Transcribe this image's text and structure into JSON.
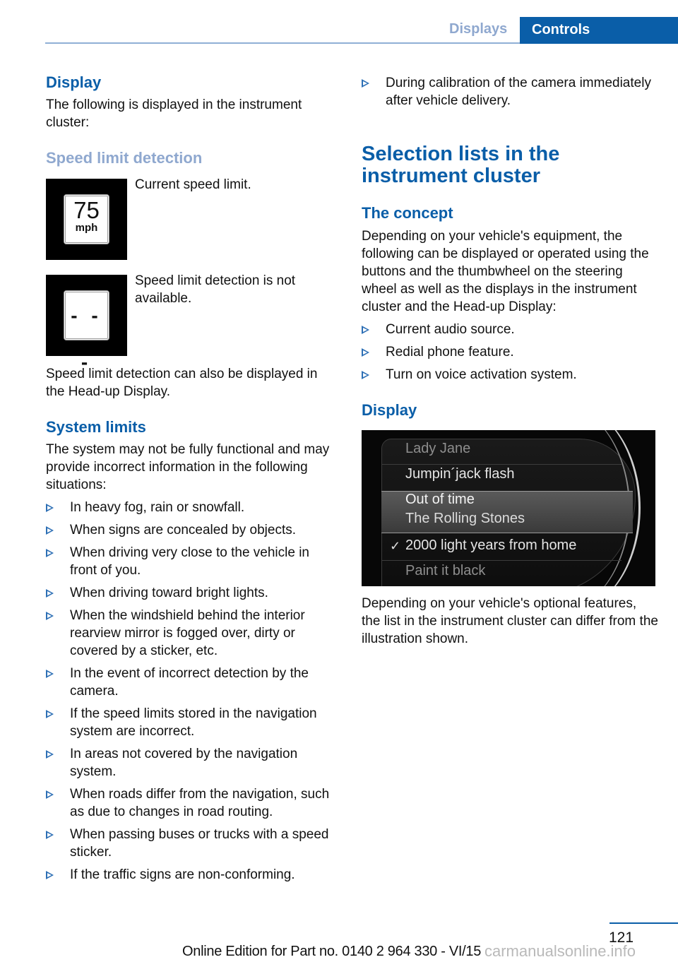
{
  "header": {
    "section_tab": "Displays",
    "chapter_tab": "Controls"
  },
  "left": {
    "display_heading": "Display",
    "display_intro": "The following is displayed in the instrument cluster:",
    "speed_heading": "Speed limit detection",
    "signs": [
      {
        "icon": "speed-limit-75-mph-sign",
        "number": "75",
        "unit": "mph",
        "caption": "Current speed limit."
      },
      {
        "icon": "speed-limit-unavailable-sign",
        "dashes": "- - -",
        "caption": "Speed limit detection is not available."
      }
    ],
    "hud_note": "Speed limit detection can also be displayed in the Head-up Display.",
    "limits_heading": "System limits",
    "limits_intro": "The system may not be fully functional and may provide incorrect information in the following situations:",
    "limits_items": [
      "In heavy fog, rain or snowfall.",
      "When signs are concealed by objects.",
      "When driving very close to the vehicle in front of you.",
      "When driving toward bright lights.",
      "When the windshield behind the interior rearview mirror is fogged over, dirty or covered by a sticker, etc.",
      "In the event of incorrect detection by the camera.",
      "If the speed limits stored in the navigation system are incorrect.",
      "In areas not covered by the navigation system.",
      "When roads differ from the navigation, such as due to changes in road routing.",
      "When passing buses or trucks with a speed sticker.",
      "If the traffic signs are non-conforming."
    ]
  },
  "right": {
    "cont_items": [
      "During calibration of the camera immediately after vehicle delivery."
    ],
    "selection_heading": "Selection lists in the instrument cluster",
    "concept_heading": "The concept",
    "concept_text": "Depending on your vehicle's equipment, the following can be displayed or operated using the buttons and the thumbwheel on the steering wheel as well as the displays in the instrument cluster and the Head-up Display:",
    "concept_items": [
      "Current audio source.",
      "Redial phone feature.",
      "Turn on voice activation system."
    ],
    "display_heading": "Display",
    "cluster_list": {
      "items": [
        {
          "text": "Lady Jane",
          "state": "dim"
        },
        {
          "text": "Jumpin´jack flash",
          "state": "normal"
        },
        {
          "text": "Out of time",
          "state": "selected"
        },
        {
          "text": "The Rolling Stones",
          "state": "selected-subtitle"
        },
        {
          "text": "2000 light years from home",
          "state": "checked"
        },
        {
          "text": "Paint it black",
          "state": "dim"
        }
      ],
      "check_glyph": "✓"
    },
    "cluster_note": "Depending on your vehicle's optional features, the list in the instrument cluster can differ from the illustration shown."
  },
  "footer": {
    "page_number": "121",
    "edition": "Online Edition for Part no. 0140 2 964 330 - VI/15",
    "watermark": "carmanualsonline.info"
  }
}
